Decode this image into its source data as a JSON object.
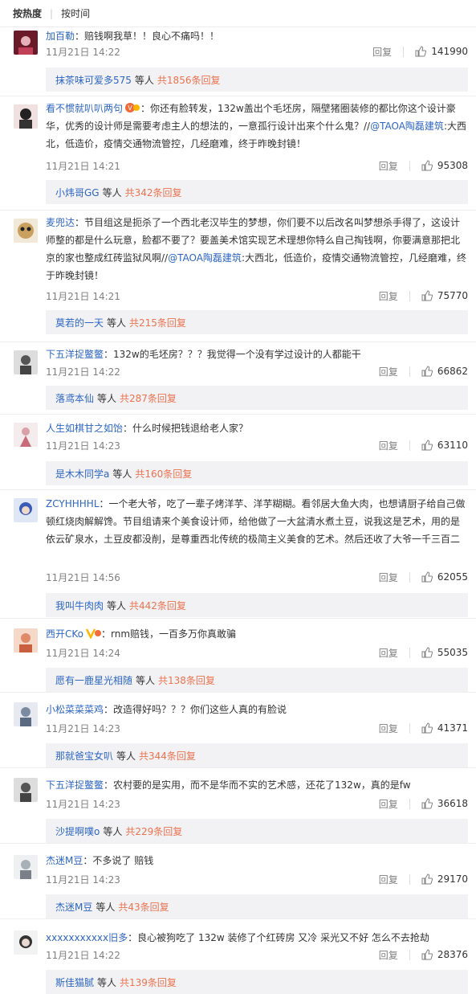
{
  "sort": {
    "hot": "按热度",
    "time": "按时间"
  },
  "reply_label": "回复",
  "reply_mid": "等人",
  "comments": [
    {
      "user": "加百勒",
      "colon": "：",
      "text": "赔钱啊我草！！良心不痛吗！！",
      "time": "11月21日 14:22",
      "likes": "141990",
      "reply_user": "抹茶味可爱多575",
      "reply_count": "共1856条回复",
      "avatar_color": "#6b1a2a"
    },
    {
      "user": "看不惯就叭叭两句",
      "colon": "：",
      "text_a": "你还有脸转发，132w盖出个毛坯房，隔壁猪圈装修的都比你这个设计豪华，优秀的设计师是需要考虑主人的想法的，一意孤行设计出来个什么鬼？//",
      "mention": "@TAOA陶磊建筑",
      "text_b": ":大西北，低造价，疫情交通物流管控，几经磨难，终于昨晚封镜！",
      "time": "11月21日 14:21",
      "likes": "95308",
      "reply_user": "小炜哥GG",
      "reply_count": "共342条回复",
      "avatar_color": "#222"
    },
    {
      "user": "麦兜达",
      "colon": "：",
      "text_a": "节目组这是扼杀了一个西北老汉毕生的梦想，你们要不以后改名叫梦想杀手得了，这设计师整的都是什么玩意，脸都不要了？要盖美术馆实现艺术理想你特么自己掏钱啊，你要满意那把北京的家也整成红砖监狱风啊//",
      "mention": "@TAOA陶磊建筑",
      "text_b": ":大西北，低造价，疫情交通物流管控，几经磨难，终于昨晚封镜！",
      "time": "11月21日 14:21",
      "likes": "75770",
      "reply_user": "莫若的一天",
      "reply_count": "共215条回复",
      "avatar_color": "#c8a060"
    },
    {
      "user": "下五洋捉鳖鳖",
      "colon": "：",
      "text": "132w的毛坯房？？？我觉得一个没有学过设计的人都能干",
      "time": "11月21日 14:22",
      "likes": "66862",
      "reply_user": "落鸢本仙",
      "reply_count": "共287条回复",
      "avatar_color": "#555"
    },
    {
      "user": "人生如棋甘之如饴",
      "colon": "：",
      "text": "什么时候把钱退给老人家？",
      "time": "11月21日 14:23",
      "likes": "63110",
      "reply_user": "是木木同学a",
      "reply_count": "共160条回复",
      "avatar_color": "#d9a0a8"
    },
    {
      "user": "ZCYHHHHL",
      "colon": "：",
      "text": "一个老大爷，吃了一辈子烤洋芋、洋芋糊糊。看邻居大鱼大肉，也想请厨子给自己做顿红烧肉解解馋。节目组请来个美食设计师，给他做了一大盆清水煮土豆，说我这是艺术，用的是依云矿泉水，土豆皮都没削，是尊重西北传统的极简主义美食的艺术。然后还收了大爷一千三百二",
      "time": "11月21日 14:56",
      "likes": "62055",
      "reply_user": "我叫牛肉肉",
      "reply_count": "共442条回复",
      "avatar_color": "#3a5ab8"
    },
    {
      "user": "西开CKo",
      "colon": "：",
      "text": "rnm赔钱，一百多万你真敢骗",
      "time": "11月21日 14:24",
      "likes": "55035",
      "reply_user": "愿有一鹿星光相随",
      "reply_count": "共138条回复",
      "avatar_color": "#e08a6a"
    },
    {
      "user": "小松菜菜菜鸡",
      "colon": "：",
      "text": "改造得好吗？？？你们这些人真的有脸说",
      "time": "11月21日 14:23",
      "likes": "41371",
      "reply_user": "那就爸宝女叭",
      "reply_count": "共344条回复",
      "avatar_color": "#7a8aa0"
    },
    {
      "user": "下五洋捉鳖鳖",
      "colon": "：",
      "text": "农村要的是实用，而不是华而不实的艺术感，还花了132w，真的是fw",
      "time": "11月21日 14:23",
      "likes": "36618",
      "reply_user": "沙提啊噗o",
      "reply_count": "共229条回复",
      "avatar_color": "#555"
    },
    {
      "user": "杰迷M豆",
      "colon": "：",
      "text": "不多说了 赔钱",
      "time": "11月21日 14:23",
      "likes": "29170",
      "reply_user": "杰迷M豆",
      "reply_count": "共43条回复",
      "avatar_color": "#a8b0b8"
    },
    {
      "user": "xxxxxxxxxxx旧多",
      "colon": "：",
      "text": "良心被狗吃了 132w 装修了个红砖房 又冷 采光又不好 怎么不去抢劫",
      "time": "11月21日 14:22",
      "likes": "28376",
      "reply_user": "斯佳猫腻",
      "reply_count": "共139条回复",
      "avatar_color": "#333"
    }
  ]
}
